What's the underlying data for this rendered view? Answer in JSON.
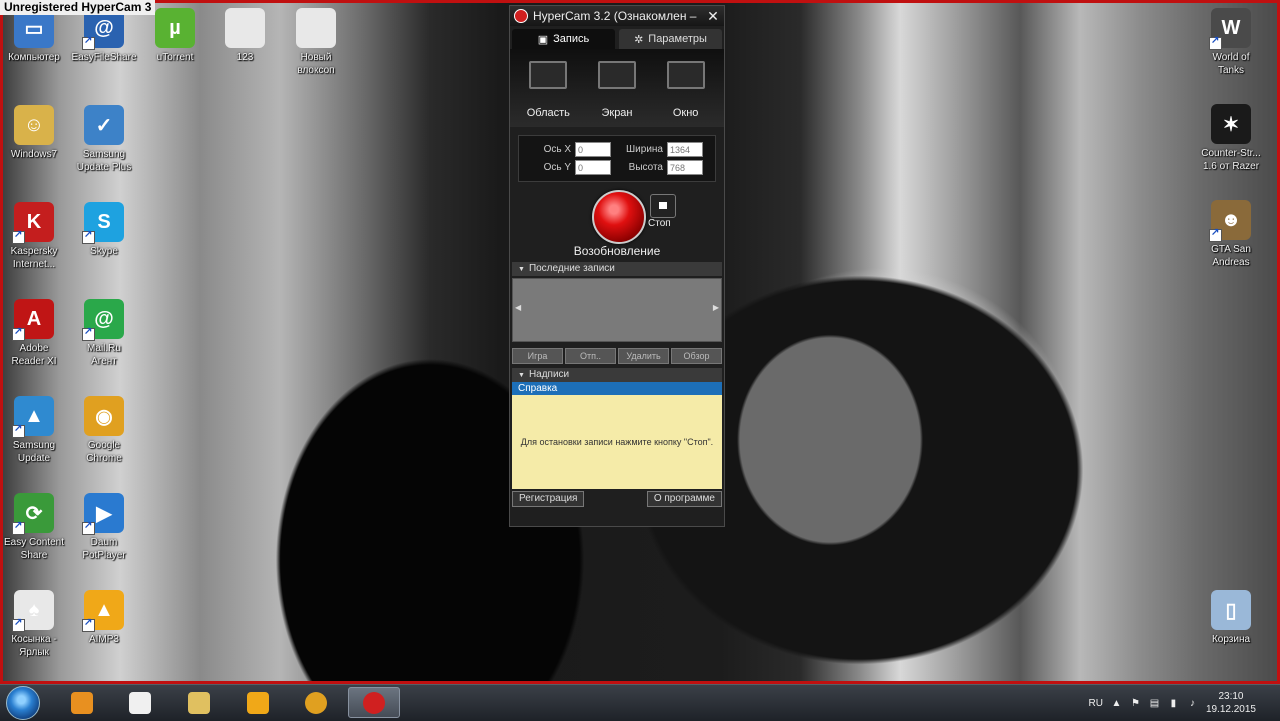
{
  "watermark": "Unregistered HyperCam 3",
  "desktop_left": [
    {
      "name": "computer",
      "label": "Компьютер",
      "icon": "computer-icon",
      "color": "#3a78c8",
      "glyph": "▭"
    },
    {
      "name": "easyfileshare",
      "label": "EasyFileShare",
      "icon": "easyfileshare-icon",
      "color": "#2a62b0",
      "glyph": "@"
    },
    {
      "name": "utorrent",
      "label": "uTorrent",
      "icon": "utorrent-icon",
      "color": "#59b232",
      "glyph": "µ"
    },
    {
      "name": "file-123",
      "label": "123",
      "icon": "file-icon",
      "color": "#e8e8e8",
      "glyph": ""
    },
    {
      "name": "new-doc",
      "label": "Новый\nвлоксоп",
      "icon": "file-icon",
      "color": "#e8e8e8",
      "glyph": ""
    },
    {
      "name": "windows7",
      "label": "Windows7",
      "icon": "folder-user-icon",
      "color": "#d9b24a",
      "glyph": "☺"
    },
    {
      "name": "samsung-update-plus",
      "label": "Samsung\nUpdate Plus",
      "icon": "samsung-update-plus-icon",
      "color": "#3d82c8",
      "glyph": "✓"
    },
    {
      "name": "kaspersky",
      "label": "Kaspersky\nInternet...",
      "icon": "kaspersky-icon",
      "color": "#c41e1e",
      "glyph": "K"
    },
    {
      "name": "skype",
      "label": "Skype",
      "icon": "skype-icon",
      "color": "#1ea2e0",
      "glyph": "S"
    },
    {
      "name": "adobe-reader",
      "label": "Adobe\nReader XI",
      "icon": "adobe-reader-icon",
      "color": "#c01515",
      "glyph": "A"
    },
    {
      "name": "mailru",
      "label": "Mail.Ru\nАгент",
      "icon": "mailru-agent-icon",
      "color": "#2aa84a",
      "glyph": "@"
    },
    {
      "name": "samsung-update",
      "label": "Samsung\nUpdate",
      "icon": "samsung-update-icon",
      "color": "#2f8ad0",
      "glyph": "▲"
    },
    {
      "name": "google-chrome",
      "label": "Google\nChrome",
      "icon": "chrome-icon",
      "color": "#e0a020",
      "glyph": "◉"
    },
    {
      "name": "easy-content-share",
      "label": "Easy Content\nShare",
      "icon": "easy-content-share-icon",
      "color": "#3a9a3a",
      "glyph": "⟳"
    },
    {
      "name": "daum-potplayer",
      "label": "Daum\nPotPlayer",
      "icon": "potplayer-icon",
      "color": "#2a7ad0",
      "glyph": "▶"
    },
    {
      "name": "kosynka",
      "label": "Косынка -\nЯрлык",
      "icon": "solitaire-icon",
      "color": "#e8e8e8",
      "glyph": "♠"
    },
    {
      "name": "aimp3",
      "label": "AIMP3",
      "icon": "aimp-icon",
      "color": "#f0a818",
      "glyph": "▲"
    }
  ],
  "desktop_right": [
    {
      "name": "world-of-tanks",
      "label": "World of\nTanks",
      "icon": "world-of-tanks-icon",
      "color": "#4a4a4a",
      "glyph": "W"
    },
    {
      "name": "counter-strike",
      "label": "Counter-Str...\n1.6 от Razer",
      "icon": "razer-icon",
      "color": "#1a1a1a",
      "glyph": "✶"
    },
    {
      "name": "gta-san-andreas",
      "label": "GTA San\nAndreas",
      "icon": "gta-icon",
      "color": "#8a6a3a",
      "glyph": "☻"
    },
    {
      "name": "recycle-bin",
      "label": "Корзина",
      "icon": "recycle-bin-icon",
      "color": "#9ab8d8",
      "glyph": "▯"
    }
  ],
  "hypercam": {
    "title": "HyperCam 3.2 (Ознакомлен –",
    "tabs": [
      "Запись",
      "Параметры"
    ],
    "modes": [
      "Область",
      "Экран",
      "Окно"
    ],
    "coords": {
      "x_label": "Ось X",
      "x_value": "0",
      "y_label": "Ось Y",
      "y_value": "0",
      "w_label": "Ширина",
      "w_value": "1364",
      "h_label": "Высота",
      "h_value": "768"
    },
    "stop_label": "Стоп",
    "resume_label": "Возобновление",
    "recent_title": "Последние записи",
    "recent_buttons": [
      "Игра",
      "Отп..",
      "Удалить",
      "Обзор"
    ],
    "captions_title": "Надписи",
    "help_tab": "Справка",
    "help_text": "Для остановки записи нажмите кнопку \"Стоп\".",
    "register_button": "Регистрация",
    "about_button": "О программе"
  },
  "taskbar": {
    "items": [
      {
        "name": "media-player",
        "icon": "media-player-icon",
        "color": "#e89020"
      },
      {
        "name": "notepad",
        "icon": "document-icon",
        "color": "#f0f0f0"
      },
      {
        "name": "explorer",
        "icon": "folder-icon",
        "color": "#e0c060"
      },
      {
        "name": "aimp",
        "icon": "aimp-icon",
        "color": "#f0a818"
      },
      {
        "name": "chrome",
        "icon": "chrome-icon",
        "color": "#e0a020"
      },
      {
        "name": "hypercam",
        "icon": "hypercam-icon",
        "color": "#d02020"
      }
    ],
    "lang": "RU",
    "time": "23:10",
    "date": "19.12.2015"
  }
}
